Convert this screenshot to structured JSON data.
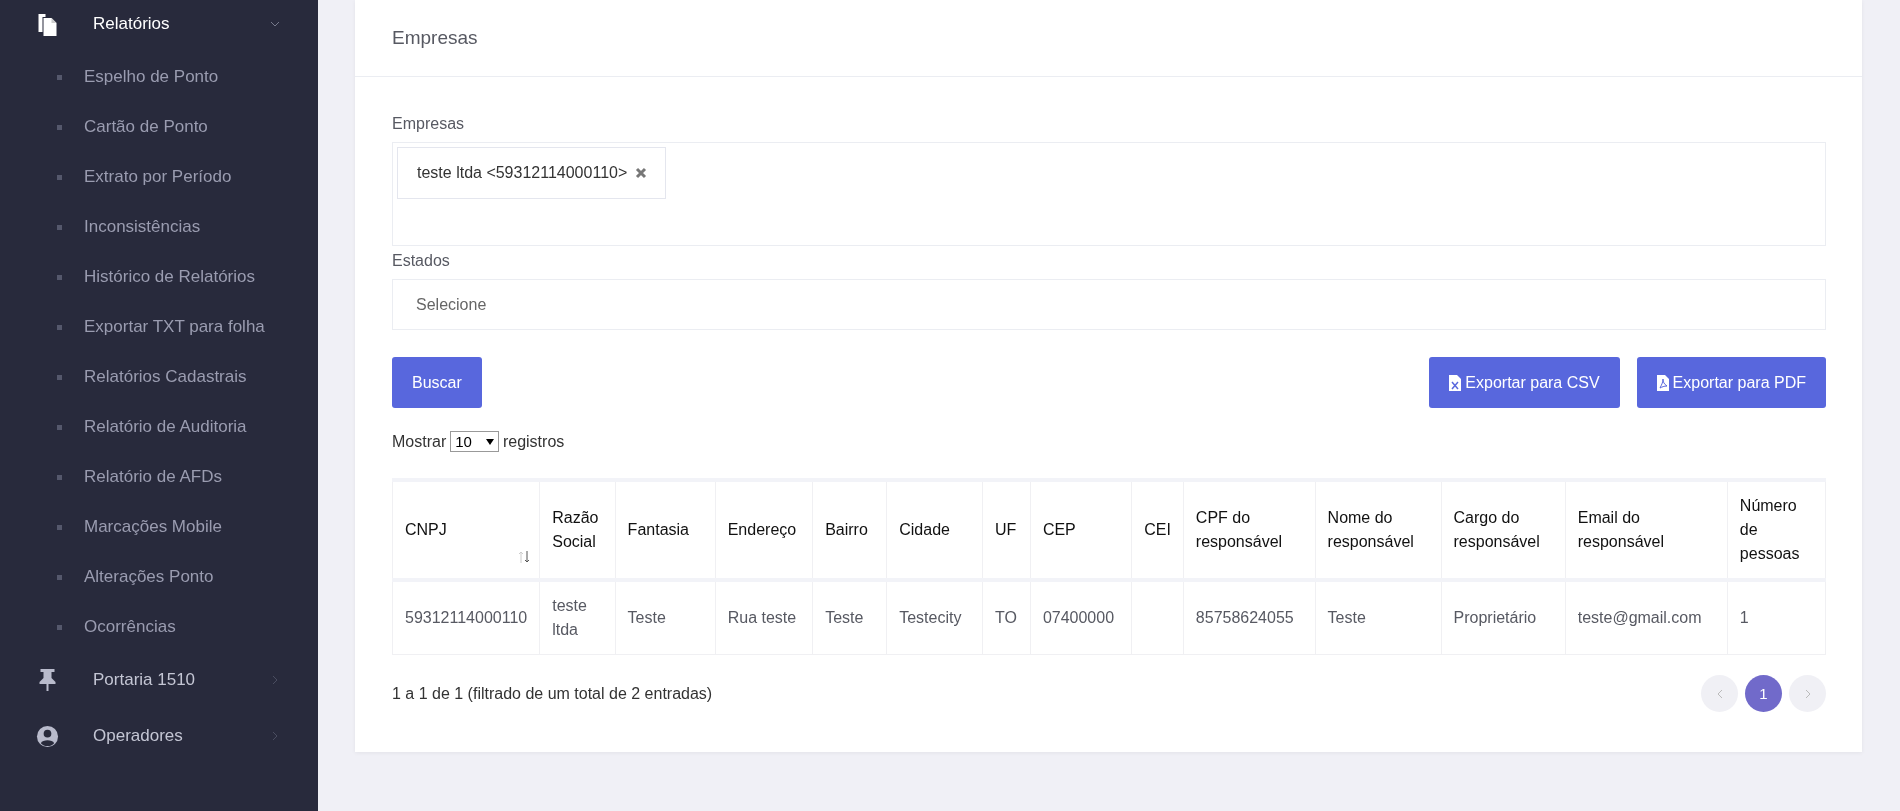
{
  "sidebar": {
    "groups": [
      {
        "label": "Relatórios",
        "expanded": true,
        "children": [
          "Espelho de Ponto",
          "Cartão de Ponto",
          "Extrato por Período",
          "Inconsistências",
          "Histórico de Relatórios",
          "Exportar TXT para folha",
          "Relatórios Cadastrais",
          "Relatório de Auditoria",
          "Relatório de AFDs",
          "Marcações Mobile",
          "Alterações Ponto",
          "Ocorrências"
        ]
      },
      {
        "label": "Portaria 1510",
        "expanded": false
      },
      {
        "label": "Operadores",
        "expanded": false
      }
    ]
  },
  "card": {
    "title": "Empresas",
    "empresas_field": {
      "label": "Empresas",
      "tags": [
        "teste ltda <59312114000110>"
      ]
    },
    "estados_field": {
      "label": "Estados",
      "placeholder": "Selecione"
    },
    "search_button": "Buscar",
    "export_buttons": [
      {
        "kind": "csv",
        "label": "Exportar para CSV"
      },
      {
        "kind": "pdf",
        "label": "Exportar para PDF"
      }
    ],
    "page_size": {
      "before": "Mostrar",
      "value": "10",
      "after": "registros"
    },
    "table": {
      "columns": [
        {
          "label": "CNPJ",
          "sort_icon": true
        },
        {
          "label": "Razão Social",
          "sort_icon": false
        },
        {
          "label": "Fantasia",
          "sort_icon": false
        },
        {
          "label": "Endereço",
          "sort_icon": false
        },
        {
          "label": "Bairro",
          "sort_icon": false
        },
        {
          "label": "Cidade",
          "sort_icon": false
        },
        {
          "label": "UF",
          "sort_icon": false
        },
        {
          "label": "CEP",
          "sort_icon": false
        },
        {
          "label": "CEI",
          "sort_icon": false
        },
        {
          "label": "CPF do responsável",
          "sort_icon": false
        },
        {
          "label": "Nome do responsável",
          "sort_icon": false
        },
        {
          "label": "Cargo do responsável",
          "sort_icon": false
        },
        {
          "label": "Email do responsável",
          "sort_icon": false
        },
        {
          "label": "Número de pessoas",
          "sort_icon": false
        }
      ],
      "rows": [
        [
          "59312114000110",
          "teste ltda",
          "Teste",
          "Rua teste",
          "Teste",
          "Testecity",
          "TO",
          "07400000",
          "",
          "85758624055",
          "Teste",
          "Proprietário",
          "teste@gmail.com",
          "1"
        ]
      ]
    },
    "info": "1 a 1 de 1 (filtrado de um total de 2 entradas)",
    "pagination": {
      "pages": [
        {
          "label": "1",
          "selected": true
        }
      ]
    }
  }
}
